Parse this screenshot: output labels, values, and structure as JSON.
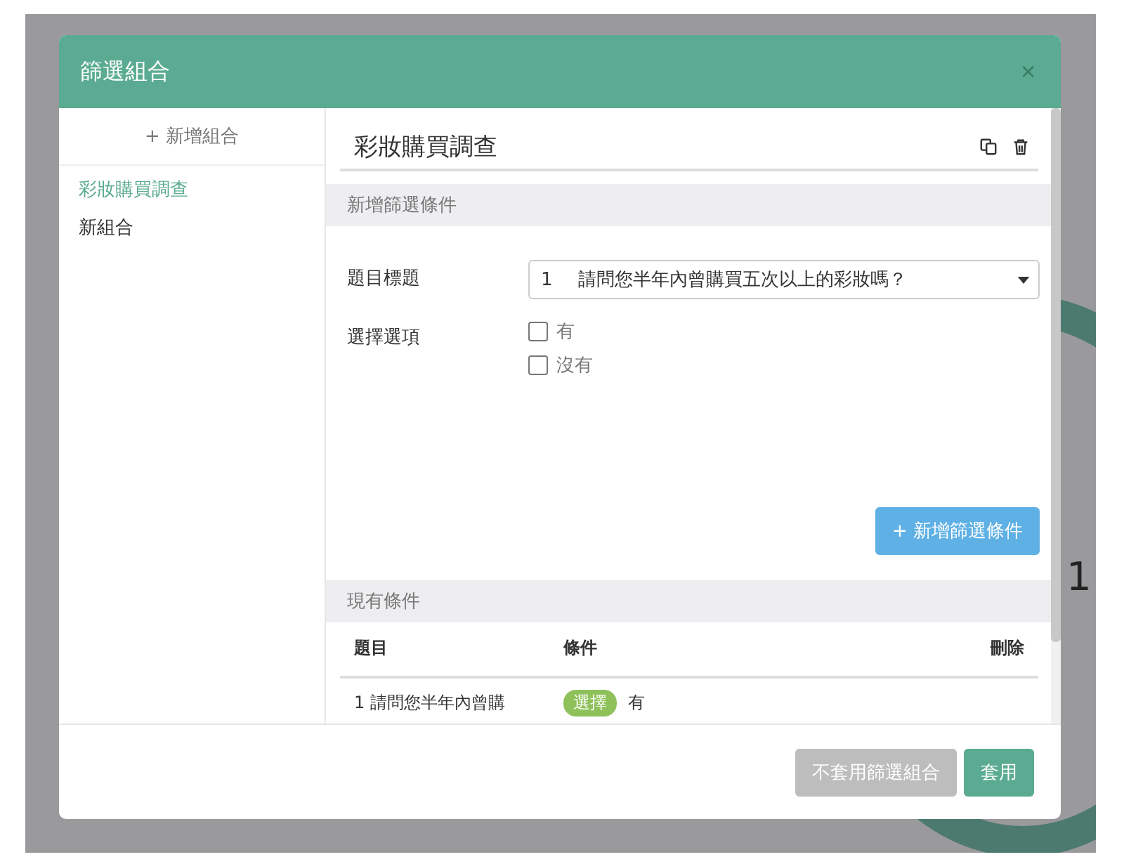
{
  "backdrop_text": "1",
  "dialog": {
    "title": "篩選組合",
    "close": "×"
  },
  "sidebar": {
    "add_label": "+ 新增組合",
    "items": [
      {
        "label": "彩妝購買調查",
        "selected": true
      },
      {
        "label": "新組合",
        "selected": false
      }
    ]
  },
  "group": {
    "name": "彩妝購買調查"
  },
  "new_condition": {
    "heading": "新增篩選條件",
    "question_label": "題目標題",
    "question_number": "1",
    "question_value": "請問您半年內曾購買五次以上的彩妝嗎？",
    "options_label": "選擇選項",
    "options": [
      {
        "label": "有",
        "checked": false
      },
      {
        "label": "沒有",
        "checked": false
      }
    ],
    "add_button": "+ 新增篩選條件"
  },
  "existing": {
    "heading": "現有條件",
    "columns": [
      "題目",
      "條件",
      "刪除"
    ],
    "rows": [
      {
        "question": "1 請問您半年內曾購",
        "tag": "選擇",
        "value": "有"
      }
    ]
  },
  "footer": {
    "buttons": [
      {
        "label": "不套用篩選組合",
        "kind": "secondary"
      },
      {
        "label": "套用",
        "kind": "primary"
      }
    ]
  }
}
